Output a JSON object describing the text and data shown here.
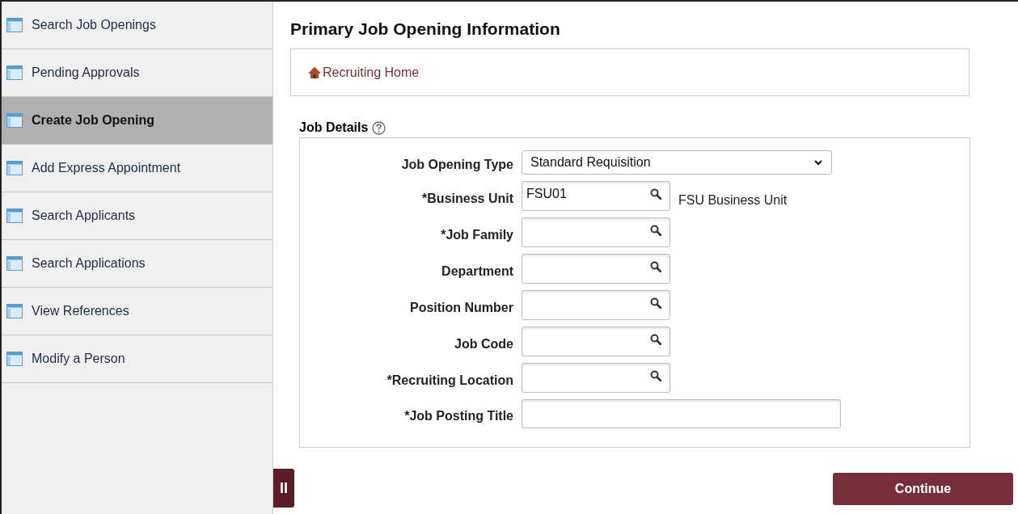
{
  "sidebar": {
    "items": [
      {
        "label": "Search Job Openings",
        "selected": false
      },
      {
        "label": "Pending Approvals",
        "selected": false
      },
      {
        "label": "Create Job Opening",
        "selected": true
      },
      {
        "label": "Add Express Appointment",
        "selected": false
      },
      {
        "label": "Search Applicants",
        "selected": false
      },
      {
        "label": "Search Applications",
        "selected": false
      },
      {
        "label": "View References",
        "selected": false
      },
      {
        "label": "Modify a Person",
        "selected": false
      }
    ]
  },
  "collapse_handle": {
    "label": "II"
  },
  "page": {
    "title": "Primary Job Opening Information",
    "breadcrumb": {
      "label": "Recruiting Home"
    },
    "section": {
      "title": "Job Details",
      "fields": [
        {
          "kind": "select",
          "label": "Job Opening Type",
          "value": "Standard Requisition"
        },
        {
          "kind": "lookup",
          "label": "*Business Unit",
          "value": "FSU01",
          "description": "FSU Business Unit"
        },
        {
          "kind": "lookup",
          "label": "*Job Family"
        },
        {
          "kind": "lookup",
          "label": "Department"
        },
        {
          "kind": "lookup",
          "label": "Position Number"
        },
        {
          "kind": "lookup",
          "label": "Job Code"
        },
        {
          "kind": "lookup",
          "label": "*Recruiting Location"
        },
        {
          "kind": "text",
          "label": "*Job Posting Title"
        }
      ]
    }
  },
  "buttons": [
    {
      "label": "Continue"
    }
  ]
}
